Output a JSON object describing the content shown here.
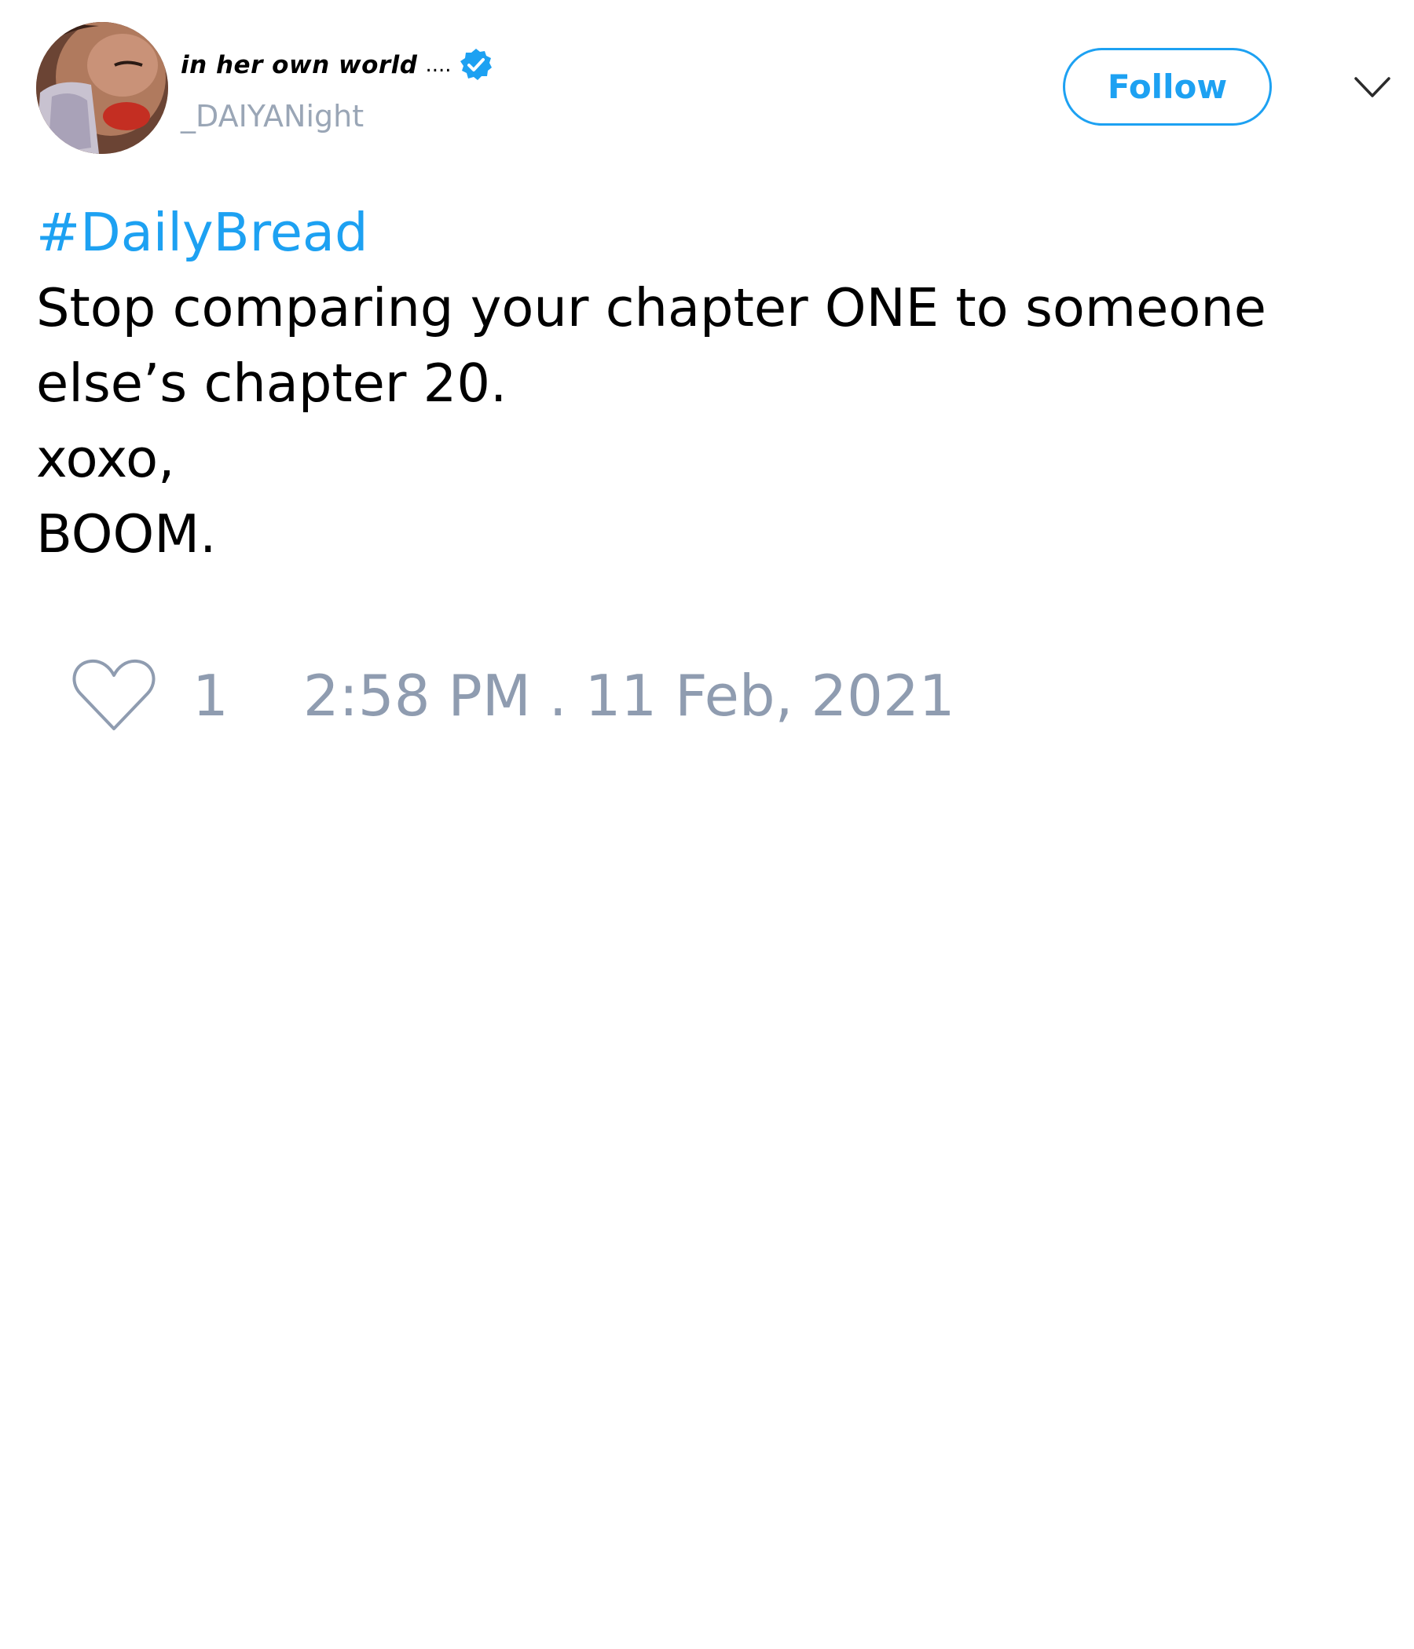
{
  "author": {
    "display_name": "in her own world",
    "name_suffix": "....",
    "handle": "_DAIYANight",
    "verified": true,
    "avatar_icon": "profile-photo"
  },
  "actions": {
    "follow_label": "Follow",
    "menu_icon": "chevron-down-icon"
  },
  "tweet": {
    "hashtag": "#DailyBread",
    "lines": [
      "Stop comparing your chapter ONE to someone",
      "else’s chapter 20.",
      "xoxo,",
      "BOOM."
    ]
  },
  "footer": {
    "like_icon": "heart-icon",
    "like_count": "1",
    "timestamp": "2:58 PM . 11 Feb, 2021"
  },
  "colors": {
    "accent": "#1da1f2",
    "muted": "#8f9cb0",
    "text": "#000000",
    "background": "#ffffff"
  }
}
